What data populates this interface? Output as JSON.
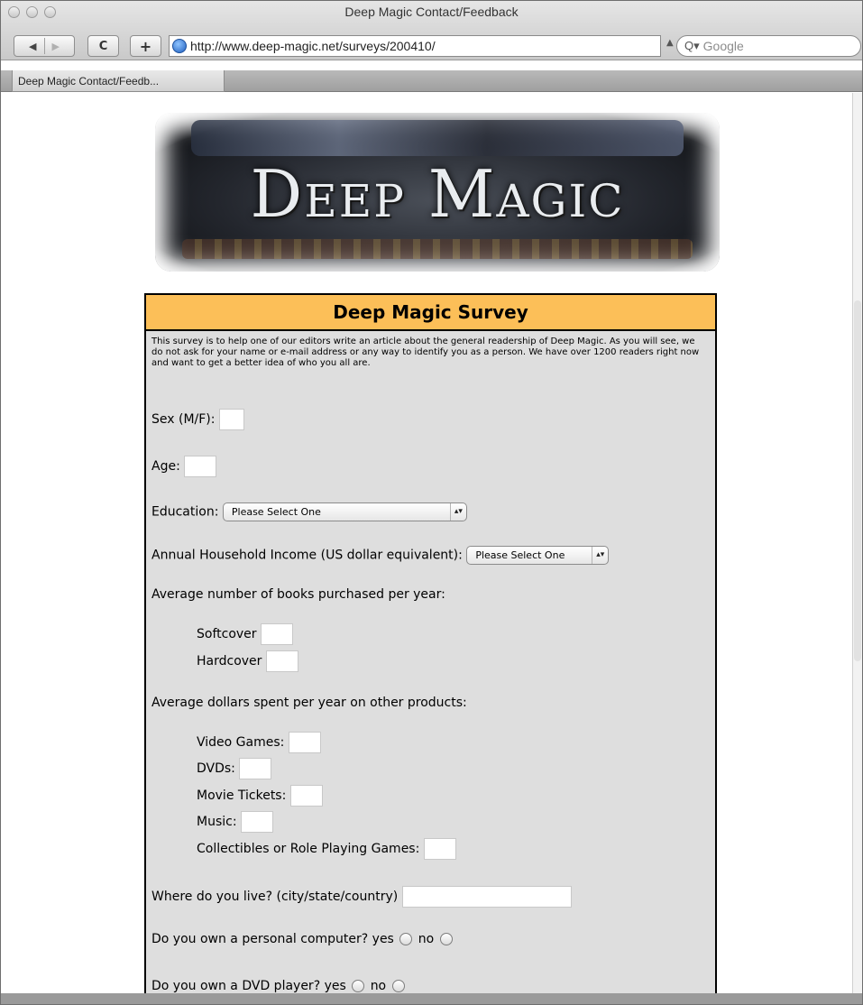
{
  "window": {
    "title": "Deep Magic Contact/Feedback",
    "url": "http://www.deep-magic.net/surveys/200410/",
    "search_placeholder": "Google",
    "tab_label": "Deep Magic Contact/Feedb..."
  },
  "banner": {
    "logo_text": "Deep Magic"
  },
  "survey": {
    "heading": "Deep Magic Survey",
    "intro": "This survey is to help one of our editors write an article about the general readership of Deep Magic. As you will see, we do not ask for your name or e-mail address or any way to identify you as a person. We have over 1200 readers right now and want to get a better idea of who you all are.",
    "sex_label": "Sex (M/F):",
    "age_label": "Age:",
    "education_label": "Education:",
    "education_value": "Please Select One",
    "income_label": "Annual Household Income (US dollar equivalent):",
    "income_value": "Please Select One",
    "books_label": "Average number of books purchased per year:",
    "softcover_label": "Softcover",
    "hardcover_label": "Hardcover",
    "dollars_label": "Average dollars spent per year on other products:",
    "video_games_label": "Video Games:",
    "dvds_label": "DVDs:",
    "movie_tickets_label": "Movie Tickets:",
    "music_label": "Music:",
    "collectibles_label": "Collectibles or Role Playing Games:",
    "location_label": "Where do you live? (city/state/country)",
    "computer_label": "Do you own a personal computer?",
    "dvd_player_label": "Do you own a DVD player?",
    "yes_label": "yes",
    "no_label": "no"
  }
}
